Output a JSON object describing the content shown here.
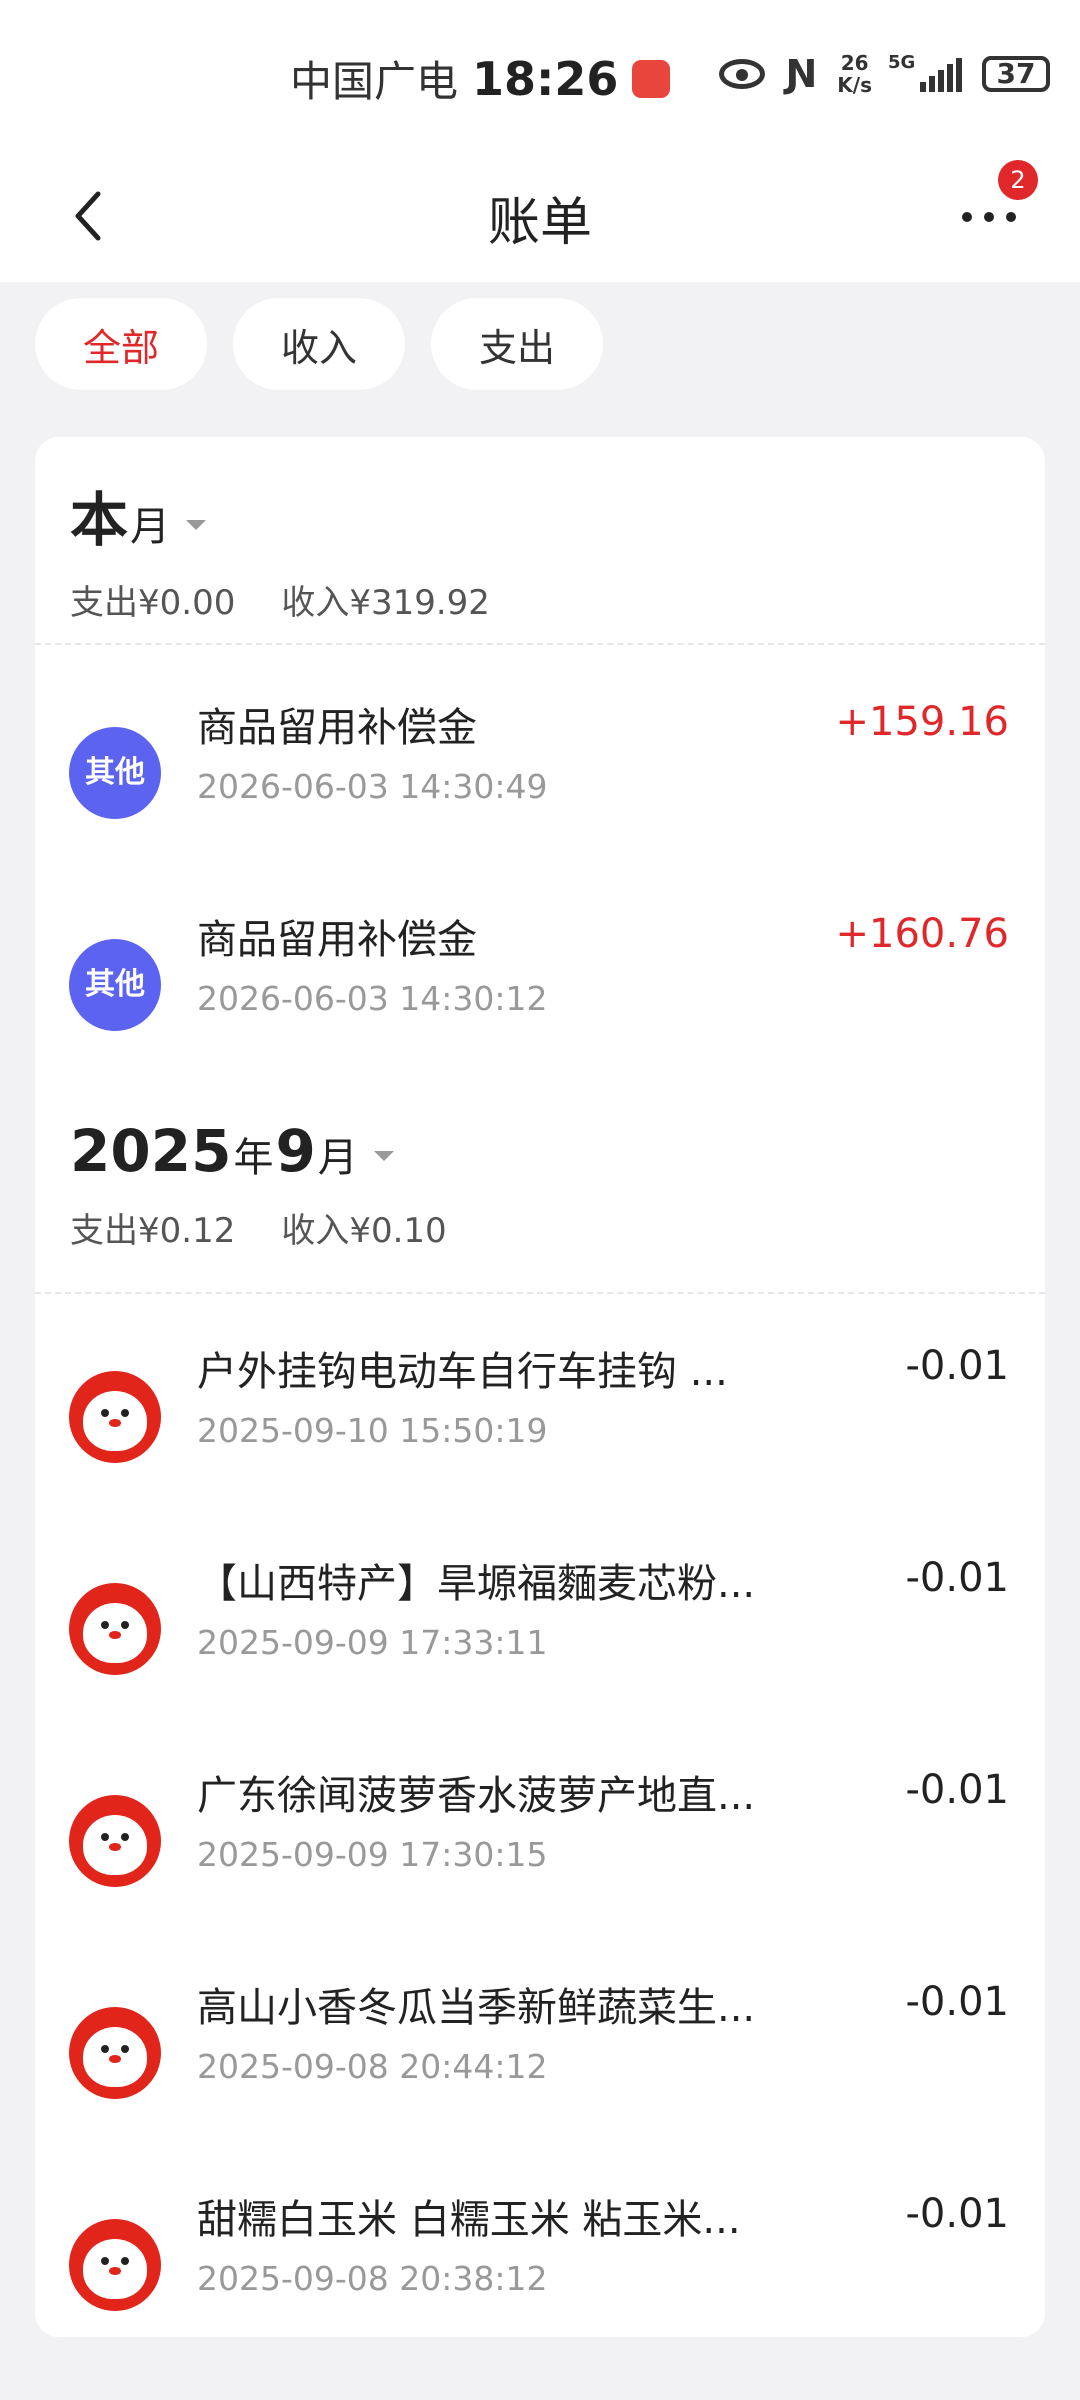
{
  "status_bar": {
    "carrier": "中国广电",
    "time": "18:26",
    "net_speed_value": "26",
    "net_speed_unit": "K/s",
    "network": "5G",
    "battery": "37"
  },
  "header": {
    "title": "账单",
    "more_badge": "2"
  },
  "filters": [
    {
      "label": "全部",
      "active": true
    },
    {
      "label": "收入",
      "active": false
    },
    {
      "label": "支出",
      "active": false
    }
  ],
  "sections": [
    {
      "title_big": "本",
      "title_small": "月",
      "title_year_suffix": "",
      "title_month": "",
      "expense": "支出¥0.00",
      "income": "收入¥319.92",
      "transactions": [
        {
          "name": "商品留用补偿金",
          "time": "2026-06-03 14:30:49",
          "amount": "+159.16",
          "type": "other",
          "icon_label": "其他"
        },
        {
          "name": "商品留用补偿金",
          "time": "2026-06-03 14:30:12",
          "amount": "+160.76",
          "type": "other",
          "icon_label": "其他"
        }
      ]
    },
    {
      "title_big": "2025",
      "title_small": "年",
      "title_month": "9",
      "title_year_suffix": "月",
      "expense": "支出¥0.12",
      "income": "收入¥0.10",
      "transactions": [
        {
          "name": "户外挂钩电动车自行车挂钩 ...",
          "time": "2025-09-10 15:50:19",
          "amount": "-0.01",
          "type": "jd"
        },
        {
          "name": "【山西特产】旱塬福麵麦芯粉...",
          "time": "2025-09-09 17:33:11",
          "amount": "-0.01",
          "type": "jd"
        },
        {
          "name": "广东徐闻菠萝香水菠萝产地直...",
          "time": "2025-09-09 17:30:15",
          "amount": "-0.01",
          "type": "jd"
        },
        {
          "name": "高山小香冬瓜当季新鲜蔬菜生...",
          "time": "2025-09-08 20:44:12",
          "amount": "-0.01",
          "type": "jd"
        },
        {
          "name": "甜糯白玉米 白糯玉米 粘玉米...",
          "time": "2025-09-08 20:38:12",
          "amount": "-0.01",
          "type": "jd"
        }
      ]
    }
  ],
  "colors": {
    "accent_red": "#e0272a",
    "other_icon_blue": "#5b63f0",
    "jd_red": "#e1251b"
  },
  "icons": {
    "back": "chevron-left-icon",
    "more": "more-horizontal-icon",
    "app_notification": "huawei-app-icon",
    "visibility": "eye-icon",
    "nfc": "nfc-icon",
    "signal": "signal-icon",
    "battery": "battery-icon"
  }
}
